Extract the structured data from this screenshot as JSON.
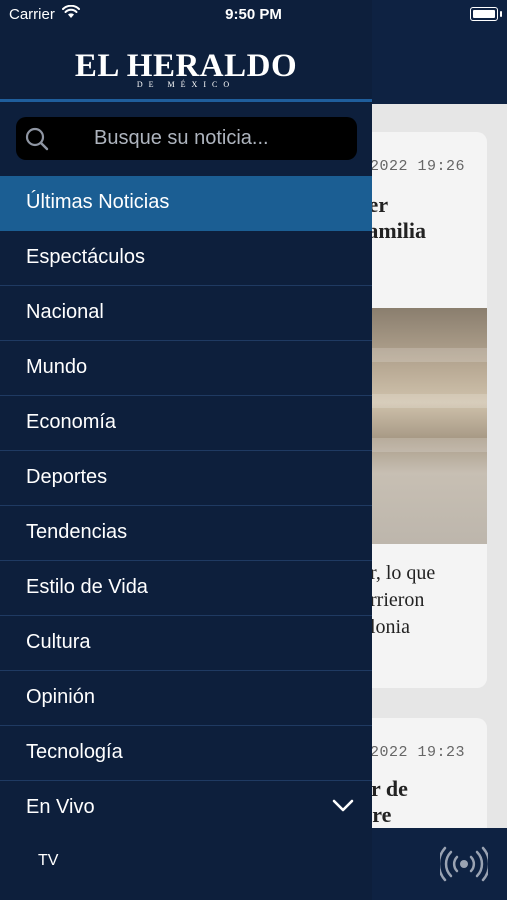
{
  "status_bar": {
    "carrier": "Carrier",
    "time": "9:50 PM"
  },
  "drawer": {
    "logo": "EL HERALDO",
    "logo_sub": "DE MÉXICO",
    "search": {
      "placeholder": "Busque su noticia..."
    },
    "menu": [
      {
        "label": "Últimas Noticias",
        "active": true
      },
      {
        "label": "Espectáculos"
      },
      {
        "label": "Nacional"
      },
      {
        "label": "Mundo"
      },
      {
        "label": "Economía"
      },
      {
        "label": "Deportes"
      },
      {
        "label": "Tendencias"
      },
      {
        "label": "Estilo de Vida"
      },
      {
        "label": "Cultura"
      },
      {
        "label": "Opinión"
      },
      {
        "label": "Tecnología"
      },
      {
        "label": "En Vivo",
        "expanded": true
      }
    ],
    "sub_menu": [
      {
        "label": "TV"
      }
    ]
  },
  "background_feed": {
    "cards": [
      {
        "date": "2022 19:26",
        "title_lines": [
          "ser",
          "familia"
        ],
        "summary_lines": [
          "or, lo que",
          "urrieron",
          "olonia"
        ]
      },
      {
        "date": "2022 19:23",
        "title_lines": [
          "or de",
          "dre"
        ]
      }
    ]
  },
  "tab_bar": {
    "icon": "live-broadcast-icon"
  },
  "colors": {
    "drawer_bg": "#0d1f3c",
    "active_item": "#1b5e93",
    "divider": "#1f3a62",
    "accent_rule": "#1f5e9c"
  }
}
